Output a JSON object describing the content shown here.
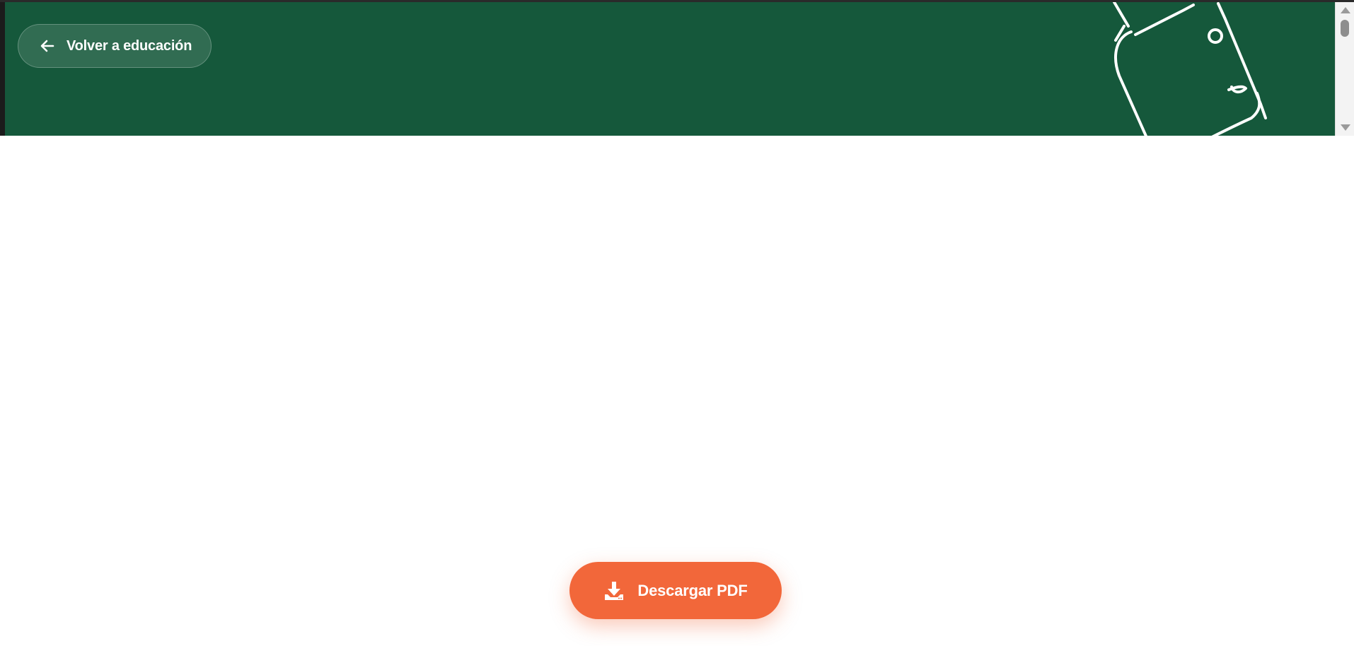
{
  "header": {
    "back_label": "Volver a educación",
    "back_icon": "arrow-left-icon",
    "illustration": "chalk-doodle-illustration"
  },
  "actions": {
    "download_label": "Descargar PDF",
    "download_icon": "download-icon"
  },
  "colors": {
    "banner": "#15583b",
    "accent": "#f2673a",
    "text_on_dark": "#ffffff"
  }
}
